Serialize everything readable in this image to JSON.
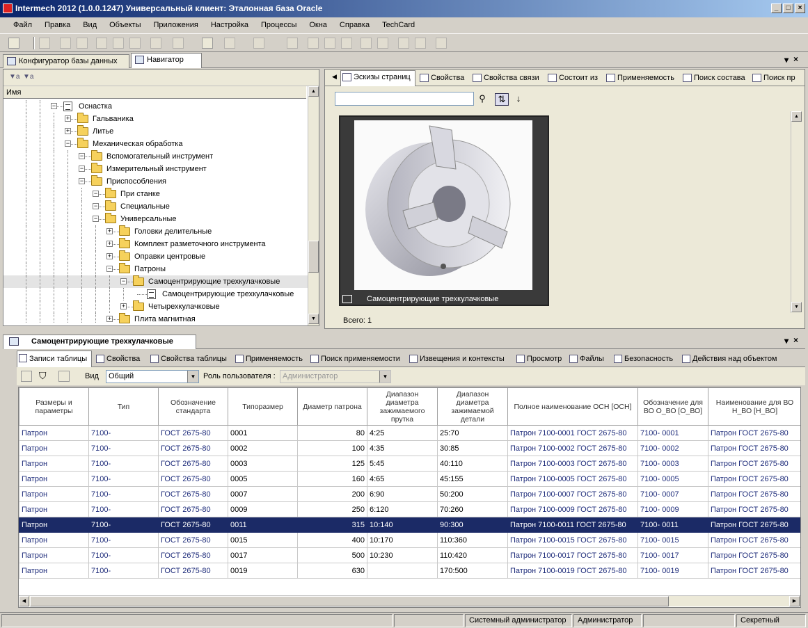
{
  "window": {
    "title": "Intermech 2012 (1.0.0.1247) Универсальный клиент: Эталонная база Oracle"
  },
  "menu": [
    "Файл",
    "Правка",
    "Вид",
    "Объекты",
    "Приложения",
    "Настройка",
    "Процессы",
    "Окна",
    "Справка",
    "TechCard"
  ],
  "top_tabs": [
    "Конфигуратор базы данных",
    "Навигатор"
  ],
  "tree": {
    "column_header": "Имя",
    "nodes": [
      {
        "label": "Оснастка",
        "level": 0
      },
      {
        "label": "Гальваника",
        "level": 1
      },
      {
        "label": "Литье",
        "level": 1
      },
      {
        "label": "Механическая обработка",
        "level": 1
      },
      {
        "label": "Вспомогательный инструмент",
        "level": 2
      },
      {
        "label": "Измерительный инструмент",
        "level": 2
      },
      {
        "label": "Приспособления",
        "level": 2
      },
      {
        "label": "При станке",
        "level": 3
      },
      {
        "label": "Специальные",
        "level": 3
      },
      {
        "label": "Универсальные",
        "level": 3
      },
      {
        "label": "Головки делительные",
        "level": 4
      },
      {
        "label": "Комплект разметочного инструмента",
        "level": 4
      },
      {
        "label": "Оправки центровые",
        "level": 4
      },
      {
        "label": "Патроны",
        "level": 4
      },
      {
        "label": "Самоцентрирующие трехкулачковые",
        "level": 5,
        "selected": true
      },
      {
        "label": "Самоцентрирующие трехкулачковые",
        "level": 6,
        "doc": true
      },
      {
        "label": "Четырехкулачковые",
        "level": 5
      },
      {
        "label": "Плита магнитная",
        "level": 4
      }
    ]
  },
  "right_tabs": [
    "Эскизы страниц",
    "Свойства",
    "Свойства связи",
    "Состоит из",
    "Применяемость",
    "Поиск состава",
    "Поиск пр"
  ],
  "search": {
    "value": ""
  },
  "thumbnail": {
    "caption": "Самоцентрирующие трехкулачковые"
  },
  "total": "Всего: 1",
  "bottom": {
    "panel_title": "Самоцентрирующие трехкулачковые",
    "tabs": [
      "Записи таблицы",
      "Свойства",
      "Свойства таблицы",
      "Применяемость",
      "Поиск применяемости",
      "Извещения и контексты",
      "Просмотр",
      "Файлы",
      "Безопасность",
      "Действия над объектом"
    ],
    "view_label": "Вид",
    "view_value": "Общий",
    "role_label": "Роль пользователя :",
    "role_value": "Администратор",
    "columns": [
      "Размеры и параметры",
      "Тип",
      "Обозначение стандарта",
      "Типоразмер",
      "Диаметр патрона",
      "Диапазон диаметра зажимаемого прутка",
      "Диапазон диаметра зажимаемой детали",
      "Полное наименование ОСН [ОСН]",
      "Обозначение для ВО О_ВО [О_ВО]",
      "Наименование для ВО Н_ВО [Н_ВО]"
    ],
    "rows": [
      [
        "Патрон",
        "7100-",
        "ГОСТ 2675-80",
        "0001",
        "80",
        "4:25",
        "25:70",
        "Патрон 7100-0001 ГОСТ 2675-80",
        "7100- 0001",
        "Патрон ГОСТ 2675-80"
      ],
      [
        "Патрон",
        "7100-",
        "ГОСТ 2675-80",
        "0002",
        "100",
        "4:35",
        "30:85",
        "Патрон 7100-0002 ГОСТ 2675-80",
        "7100- 0002",
        "Патрон ГОСТ 2675-80"
      ],
      [
        "Патрон",
        "7100-",
        "ГОСТ 2675-80",
        "0003",
        "125",
        "5:45",
        "40:110",
        "Патрон 7100-0003 ГОСТ 2675-80",
        "7100- 0003",
        "Патрон ГОСТ 2675-80"
      ],
      [
        "Патрон",
        "7100-",
        "ГОСТ 2675-80",
        "0005",
        "160",
        "4:65",
        "45:155",
        "Патрон 7100-0005 ГОСТ 2675-80",
        "7100- 0005",
        "Патрон ГОСТ 2675-80"
      ],
      [
        "Патрон",
        "7100-",
        "ГОСТ 2675-80",
        "0007",
        "200",
        "6:90",
        "50:200",
        "Патрон 7100-0007 ГОСТ 2675-80",
        "7100- 0007",
        "Патрон ГОСТ 2675-80"
      ],
      [
        "Патрон",
        "7100-",
        "ГОСТ 2675-80",
        "0009",
        "250",
        "6:120",
        "70:260",
        "Патрон 7100-0009 ГОСТ 2675-80",
        "7100- 0009",
        "Патрон ГОСТ 2675-80"
      ],
      [
        "Патрон",
        "7100-",
        "ГОСТ 2675-80",
        "0011",
        "315",
        "10:140",
        "90:300",
        "Патрон 7100-0011 ГОСТ 2675-80",
        "7100- 0011",
        "Патрон ГОСТ 2675-80"
      ],
      [
        "Патрон",
        "7100-",
        "ГОСТ 2675-80",
        "0015",
        "400",
        "10:170",
        "110:360",
        "Патрон 7100-0015 ГОСТ 2675-80",
        "7100- 0015",
        "Патрон ГОСТ 2675-80"
      ],
      [
        "Патрон",
        "7100-",
        "ГОСТ 2675-80",
        "0017",
        "500",
        "10:230",
        "110:420",
        "Патрон 7100-0017 ГОСТ 2675-80",
        "7100- 0017",
        "Патрон ГОСТ 2675-80"
      ],
      [
        "Патрон",
        "7100-",
        "ГОСТ 2675-80",
        "0019",
        "630",
        "",
        "170:500",
        "Патрон 7100-0019 ГОСТ 2675-80",
        "7100- 0019",
        "Патрон ГОСТ 2675-80"
      ]
    ],
    "selected_row": 6
  },
  "status": {
    "user": "Системный администратор",
    "role": "Администратор",
    "security": "Секретный"
  },
  "colors": {
    "selection": "#1b2a66",
    "link_text": "#1d2b7a",
    "title_start": "#0a246a",
    "title_end": "#a6caf0"
  }
}
